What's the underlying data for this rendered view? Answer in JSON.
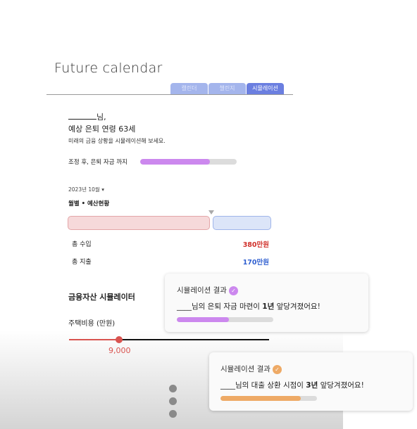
{
  "app": {
    "title": "Future calendar"
  },
  "tabs": [
    {
      "label": "캘린더"
    },
    {
      "label": "챌린지"
    },
    {
      "label": "시뮬레이션",
      "active": true
    }
  ],
  "profile": {
    "name_suffix": "님,",
    "retire_age": "예상 은퇴 연령 63세",
    "hint": "미래의 금융 상황을 시뮬레이션해 보세요."
  },
  "progress": {
    "label": "조정 후, 은퇴 자금 까지",
    "value": 0.72,
    "color": "#cc88ee"
  },
  "budget": {
    "month": "2023년 10월 ▾",
    "title": "월별 • 예산현황",
    "income_label": "총 수입",
    "income_value": "380만원",
    "expense_label": "총 지출",
    "expense_value": "170만원",
    "income_color": "#d0302a",
    "expense_color": "#2f5fd0",
    "income_share": 0.69
  },
  "simulator": {
    "title": "금융자산 시뮬레이터",
    "slider_label": "주택비용 (만원)",
    "slider_value": "9,000",
    "slider_fraction": 0.25
  },
  "results": [
    {
      "title": "시뮬레이션 결과",
      "text_pre": "____님의 은퇴 자금 마련이 ",
      "text_bold": "1년",
      "text_post": " 앞당겨졌어요!",
      "progress": 0.54,
      "color": "#cc88ee"
    },
    {
      "title": "시뮬레이션 결과",
      "text_pre": "____님의 대출 상환 시점이 ",
      "text_bold": "3년",
      "text_post": " 앞당겨졌어요!",
      "progress": 0.83,
      "color": "#eeaa66"
    }
  ]
}
